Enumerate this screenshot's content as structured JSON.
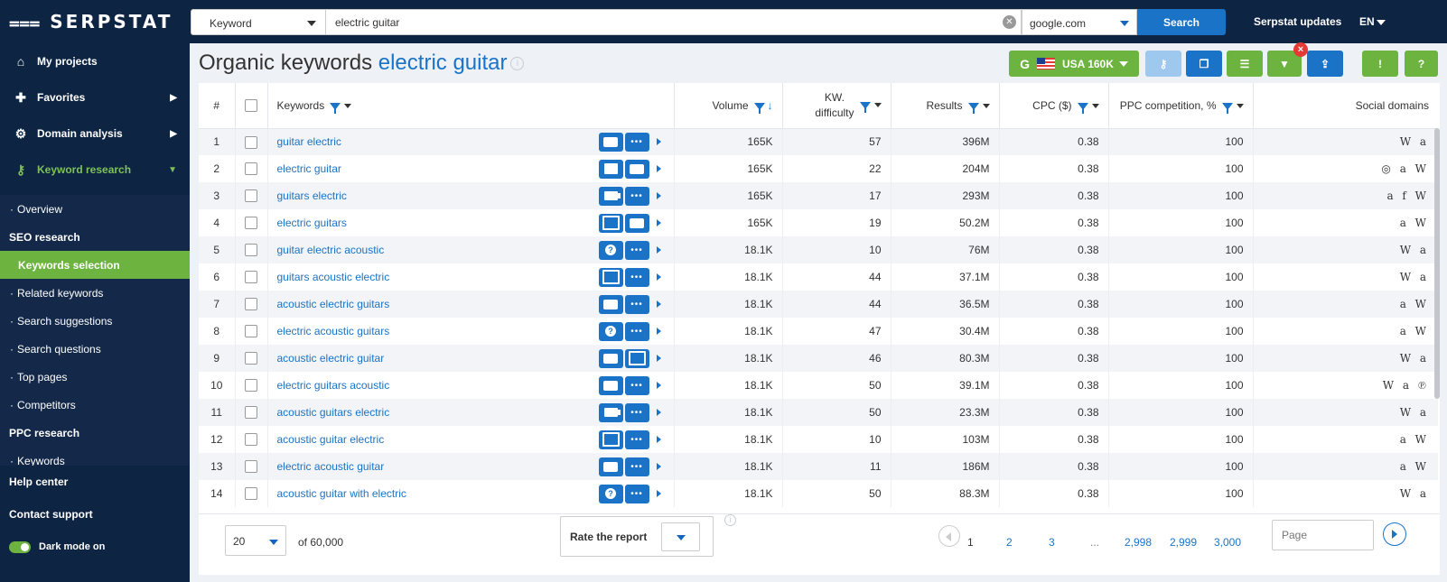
{
  "app": {
    "logo": "SERPSTAT"
  },
  "sidebar": {
    "main": [
      {
        "label": "My projects",
        "icon": "home-icon"
      },
      {
        "label": "Favorites",
        "icon": "pin-icon"
      },
      {
        "label": "Domain analysis",
        "icon": "domain-analysis-icon"
      },
      {
        "label": "Keyword research",
        "icon": "key-icon"
      }
    ],
    "sub": [
      {
        "label": "Overview"
      },
      {
        "label": "SEO research"
      },
      {
        "label": "Keywords selection"
      },
      {
        "label": "Related keywords"
      },
      {
        "label": "Search suggestions"
      },
      {
        "label": "Search questions"
      },
      {
        "label": "Top pages"
      },
      {
        "label": "Competitors"
      },
      {
        "label": "PPC research"
      },
      {
        "label": "Keywords"
      }
    ],
    "bottom": {
      "help": "Help center",
      "support": "Contact support",
      "dark_mode": "Dark mode on"
    }
  },
  "search": {
    "type": "Keyword",
    "query": "electric guitar",
    "engine": "google.com",
    "button": "Search"
  },
  "topnav": {
    "updates": "Serpstat updates",
    "lang": "EN"
  },
  "header": {
    "title_prefix": "Organic keywords",
    "title_keyword": "electric guitar",
    "info": "i",
    "region": "USA 160K",
    "google_mark": "G"
  },
  "colors": {
    "accent": "#1a73c7",
    "green": "#6db33f",
    "sidebar": "#0d2443"
  },
  "table": {
    "columns": {
      "num": "#",
      "keywords": "Keywords",
      "volume": "Volume",
      "kd_line1": "KW.",
      "kd_line2": "difficulty",
      "results": "Results",
      "cpc": "CPC ($)",
      "ppc": "PPC competition, %",
      "social": "Social domains"
    },
    "rows": [
      {
        "n": "1",
        "kw": "guitar electric",
        "f1": "comment",
        "f2": "more",
        "vol": "165K",
        "kd": "57",
        "res": "396M",
        "cpc": "0.38",
        "ppc": "100",
        "soc": "W a"
      },
      {
        "n": "2",
        "kw": "electric guitar",
        "f1": "blank",
        "f2": "comment",
        "vol": "165K",
        "kd": "22",
        "res": "204M",
        "cpc": "0.38",
        "ppc": "100",
        "soc": "◎ a W"
      },
      {
        "n": "3",
        "kw": "guitars electric",
        "f1": "video",
        "f2": "more",
        "vol": "165K",
        "kd": "17",
        "res": "293M",
        "cpc": "0.38",
        "ppc": "100",
        "soc": "a f W"
      },
      {
        "n": "4",
        "kw": "electric guitars",
        "f1": "image",
        "f2": "comment",
        "vol": "165K",
        "kd": "19",
        "res": "50.2M",
        "cpc": "0.38",
        "ppc": "100",
        "soc": "a W"
      },
      {
        "n": "5",
        "kw": "guitar electric acoustic",
        "f1": "faq",
        "f2": "more",
        "vol": "18.1K",
        "kd": "10",
        "res": "76M",
        "cpc": "0.38",
        "ppc": "100",
        "soc": "W a"
      },
      {
        "n": "6",
        "kw": "guitars acoustic electric",
        "f1": "image",
        "f2": "more",
        "vol": "18.1K",
        "kd": "44",
        "res": "37.1M",
        "cpc": "0.38",
        "ppc": "100",
        "soc": "W a"
      },
      {
        "n": "7",
        "kw": "acoustic electric guitars",
        "f1": "comment",
        "f2": "more",
        "vol": "18.1K",
        "kd": "44",
        "res": "36.5M",
        "cpc": "0.38",
        "ppc": "100",
        "soc": "a W"
      },
      {
        "n": "8",
        "kw": "electric acoustic guitars",
        "f1": "faq",
        "f2": "more",
        "vol": "18.1K",
        "kd": "47",
        "res": "30.4M",
        "cpc": "0.38",
        "ppc": "100",
        "soc": "a W"
      },
      {
        "n": "9",
        "kw": "acoustic electric guitar",
        "f1": "comment",
        "f2": "image",
        "vol": "18.1K",
        "kd": "46",
        "res": "80.3M",
        "cpc": "0.38",
        "ppc": "100",
        "soc": "W a"
      },
      {
        "n": "10",
        "kw": "electric guitars acoustic",
        "f1": "comment",
        "f2": "more",
        "vol": "18.1K",
        "kd": "50",
        "res": "39.1M",
        "cpc": "0.38",
        "ppc": "100",
        "soc": "W a ℗"
      },
      {
        "n": "11",
        "kw": "acoustic guitars electric",
        "f1": "video",
        "f2": "more",
        "vol": "18.1K",
        "kd": "50",
        "res": "23.3M",
        "cpc": "0.38",
        "ppc": "100",
        "soc": "W a"
      },
      {
        "n": "12",
        "kw": "acoustic guitar electric",
        "f1": "image",
        "f2": "more",
        "vol": "18.1K",
        "kd": "10",
        "res": "103M",
        "cpc": "0.38",
        "ppc": "100",
        "soc": "a W"
      },
      {
        "n": "13",
        "kw": "electric acoustic guitar",
        "f1": "comment",
        "f2": "more",
        "vol": "18.1K",
        "kd": "11",
        "res": "186M",
        "cpc": "0.38",
        "ppc": "100",
        "soc": "a W"
      },
      {
        "n": "14",
        "kw": "acoustic guitar with electric",
        "f1": "faq",
        "f2": "more",
        "vol": "18.1K",
        "kd": "50",
        "res": "88.3M",
        "cpc": "0.38",
        "ppc": "100",
        "soc": "W a"
      }
    ]
  },
  "footer": {
    "per_page": "20",
    "of_total": "of 60,000",
    "rate_label": "Rate the report",
    "pages": [
      "1",
      "2",
      "3",
      "...",
      "2,998",
      "2,999",
      "3,000"
    ],
    "page_placeholder": "Page"
  }
}
